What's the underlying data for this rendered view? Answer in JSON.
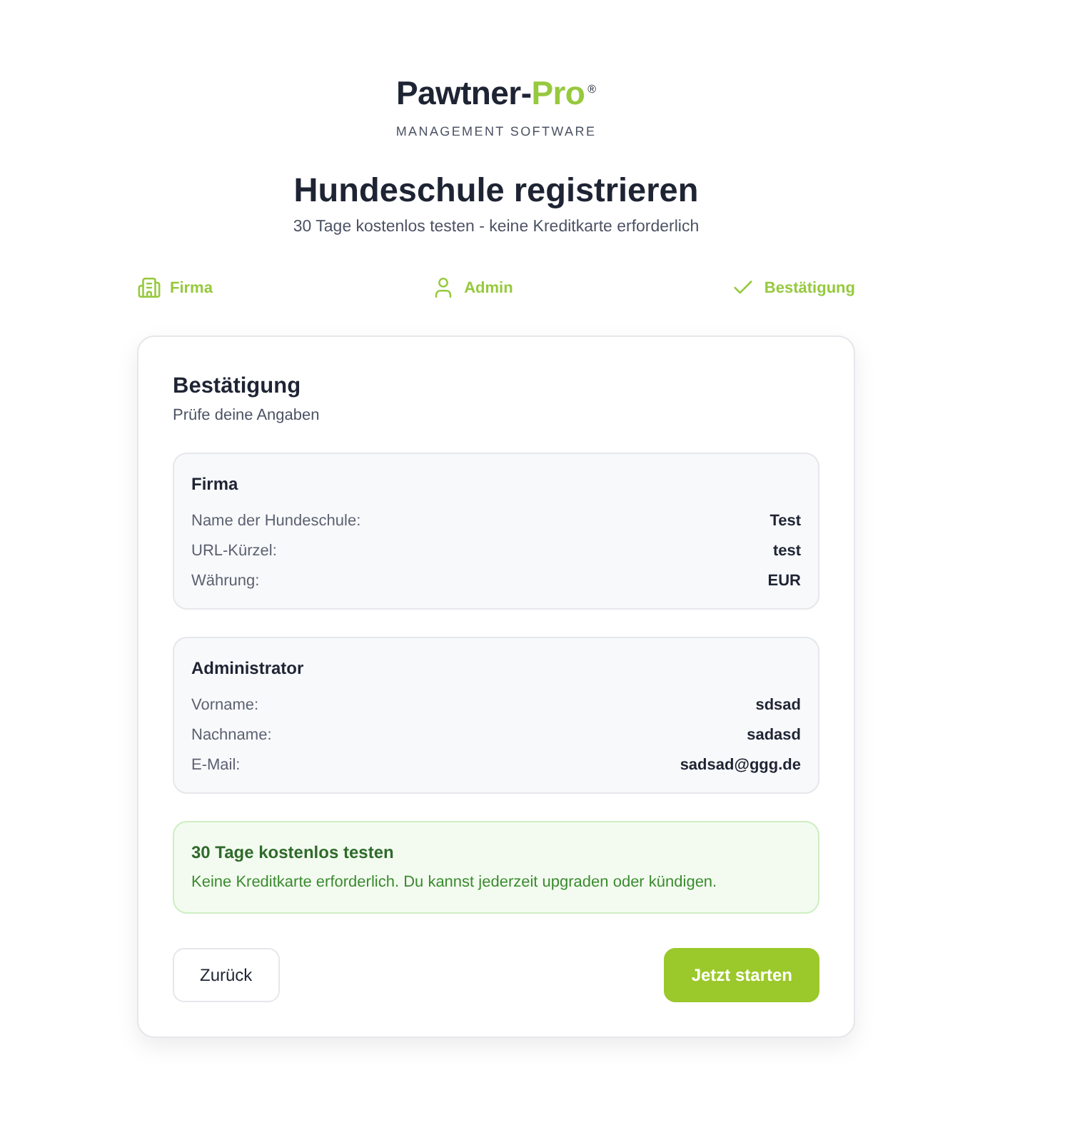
{
  "logo": {
    "name": "Pawtner-",
    "accent": "Pro",
    "mark": "®",
    "tagline": "MANAGEMENT SOFTWARE"
  },
  "header": {
    "title": "Hundeschule registrieren",
    "subtitle": "30 Tage kostenlos testen - keine Kreditkarte erforderlich"
  },
  "steps": [
    {
      "kind": "building",
      "label": "Firma",
      "completed": true
    },
    {
      "kind": "user",
      "label": "Admin",
      "completed": true
    },
    {
      "kind": "check",
      "label": "Bestätigung",
      "completed": true
    }
  ],
  "card": {
    "title": "Bestätigung",
    "subtitle": "Prüfe deine Angaben",
    "sections": [
      {
        "title": "Firma",
        "rows": [
          {
            "label": "Name der Hundeschule:",
            "value": "Test"
          },
          {
            "label": "URL-Kürzel:",
            "value": "test"
          },
          {
            "label": "Währung:",
            "value": "EUR"
          }
        ]
      },
      {
        "title": "Administrator",
        "rows": [
          {
            "label": "Vorname:",
            "value": "sdsad"
          },
          {
            "label": "Nachname:",
            "value": "sadasd"
          },
          {
            "label": "E-Mail:",
            "value": "sadsad@ggg.de"
          }
        ]
      }
    ],
    "notice": {
      "title": "30 Tage kostenlos testen",
      "text": "Keine Kreditkarte erforderlich. Du kannst jederzeit upgraden oder kündigen."
    },
    "buttons": [
      {
        "kind": "secondary",
        "label": "Zurück"
      },
      {
        "kind": "primary",
        "label": "Jetzt starten"
      }
    ]
  }
}
